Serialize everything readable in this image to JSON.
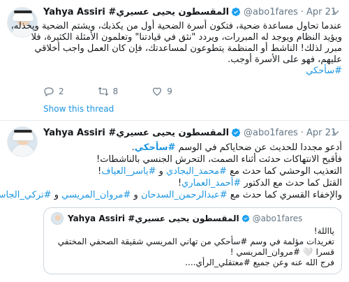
{
  "tweet1": {
    "author_name": "Yahya Assiri #المقسطون يحيى عسيري",
    "handle": "@abo1fares",
    "dot": "·",
    "time": "Apr 21",
    "lines": [
      "عندما تحاول مساعدة ضحية، فتكون أسرة الضحية أول من يكذبك، ويشتم الضحية ويخذله،",
      "ويؤيد النظام ويوجد له المبررات، ويردد \"نثق في قيادتنا\" وتعلمون الأمثلة الكثيرة، فلا",
      "مبرر لذلك! الناشط أو المنظمة يتطوعون لمساعدتك، فإن كان العمل واجب أخلاقي",
      "عليهم، فهو على الأسرة أوجب."
    ],
    "hashtag": "#سأحكي",
    "replies": "2",
    "retweets": "8",
    "likes": "9",
    "show_thread": "Show this thread"
  },
  "tweet2": {
    "author_name": "Yahya Assiri #المقسطون يحيى عسيري",
    "handle": "@abo1fares",
    "dot": "·",
    "time": "Apr 21",
    "line1_text": "أدعو مجددا للحديث عن ضحاياكم في الوسم ",
    "line1_tag": "#سأحكي",
    "line1_end": ".",
    "line2": "فأقبح الانتهاكات حدثت أثناء الصمت، التحرش الجنسي بالناشطات!",
    "line3_text": "التعذيب الوحشي كما حدث مع ",
    "line3_tag1": "#محمد_البجادي",
    "line3_and": " و ",
    "line3_tag2": "#ياسر_العياف",
    "line3_end": "!",
    "line4_text": "القتل كما حدث مع الدكتور ",
    "line4_tag": "#أحمد_العماري",
    "line4_end": "!",
    "line5_text": "والإخفاء القسري كما حدث مع ",
    "line5_tag1": "#عبدالرحمن_السدحان",
    "line5_and1": " و ",
    "line5_tag2": "#مروان_المريسي",
    "line5_and2": " و ",
    "line5_tag3": "#تركي_الجاسر"
  },
  "quote": {
    "author_name": "Yahya Assiri #المقسطون يحيى عسيري",
    "handle": "@abo1fares",
    "lines": [
      "يااللة!",
      "تغريدات مؤلمة في وسم #سأحكي من تهاني المريسي شقيقة الصحفي المختفي",
      "قسرا 🤍 #مروان_المريسي !",
      "فرج الله عنه وعن جميع #معتقلي_الرأي...."
    ]
  },
  "colors": {
    "link": "#1b95e0",
    "muted": "#657786",
    "border": "#e6ecf0",
    "like_icon": "#657786"
  },
  "icons": [
    "reply-icon",
    "retweet-icon",
    "like-icon",
    "verified-icon",
    "caret-down-icon"
  ]
}
